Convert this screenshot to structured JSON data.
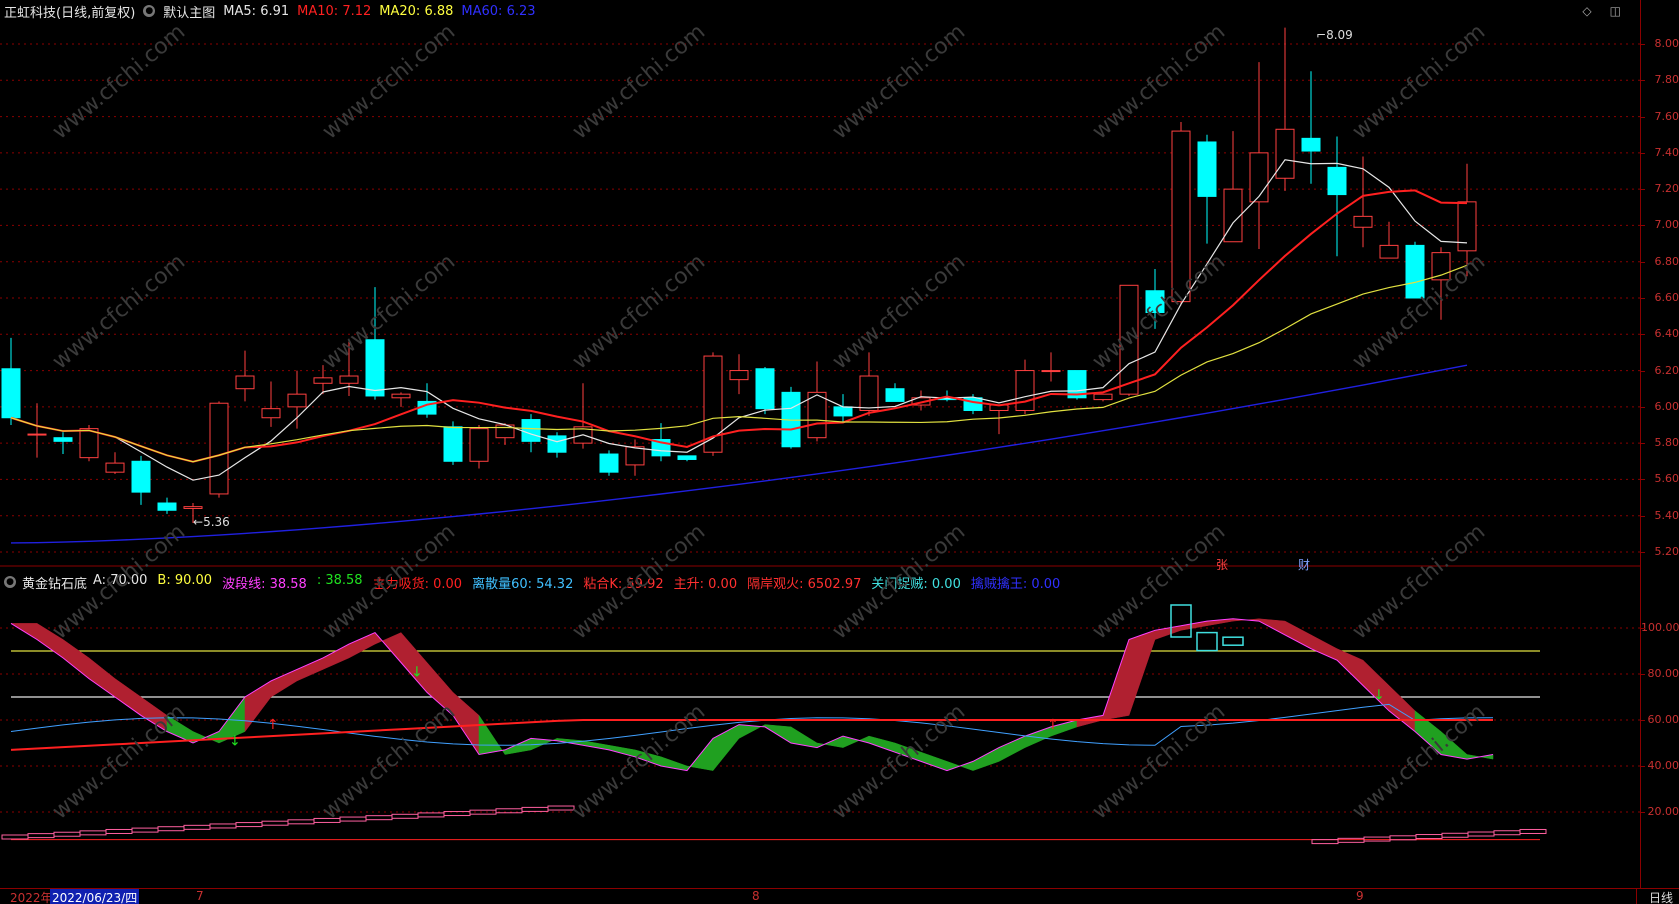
{
  "main_header": {
    "stock_name": "正虹科技(日线,前复权)",
    "chart_name": "默认主图",
    "ma": [
      {
        "label": "MA5:",
        "value": "6.91",
        "color": "#e6e6e6"
      },
      {
        "label": "MA10:",
        "value": "7.12",
        "color": "#ff2020"
      },
      {
        "label": "MA20:",
        "value": "6.88",
        "color": "#ffff40"
      },
      {
        "label": "MA60:",
        "value": "6.23",
        "color": "#3030ff"
      }
    ]
  },
  "sub_header": {
    "indicator_name": "黄金钻石底",
    "items": [
      {
        "label": "A:",
        "value": "70.00",
        "color": "#e6e6e6"
      },
      {
        "label": "B:",
        "value": "90.00",
        "color": "#ffff40"
      },
      {
        "label": "波段线:",
        "value": "38.58",
        "color": "#ff40ff"
      },
      {
        "label": ":",
        "value": "38.58",
        "color": "#20e020"
      },
      {
        "label": "主力吸货:",
        "value": "0.00",
        "color": "#ff2020"
      },
      {
        "label": "离散量60:",
        "value": "54.32",
        "color": "#40c0ff"
      },
      {
        "label": "粘合K:",
        "value": "59.92",
        "color": "#ff3030"
      },
      {
        "label": "主升:",
        "value": "0.00",
        "color": "#ff3030"
      },
      {
        "label": "隔岸观火:",
        "value": "6502.97",
        "color": "#ff3030"
      },
      {
        "label": "关门捉贼:",
        "value": "0.00",
        "color": "#40e0e0"
      },
      {
        "label": "擒贼擒王:",
        "value": "0.00",
        "color": "#3030ff"
      }
    ]
  },
  "main_axis": [
    "8.00",
    "7.80",
    "7.60",
    "7.40",
    "7.20",
    "7.00",
    "6.80",
    "6.60",
    "6.40",
    "6.20",
    "6.00",
    "5.80",
    "5.60",
    "5.40",
    "5.20"
  ],
  "sub_axis": [
    "100.00",
    "80.00",
    "60.00",
    "40.00",
    "20.00"
  ],
  "annotations": {
    "high": "8.09",
    "low": "5.36"
  },
  "badges": {
    "zhang": "张",
    "cai": "财"
  },
  "footer": {
    "year": "2022年",
    "date": "2022/06/23/四",
    "months": [
      "7",
      "8",
      "9"
    ],
    "period": "日线"
  },
  "watermark": "www.cfchi.com",
  "colors": {
    "up": "#ff4040",
    "down": "#00ffff",
    "ma5": "#e6e6e6",
    "ma10": "#ff2020",
    "ma20": "#e0e040",
    "ma60": "#2020e0",
    "grid": "#8b0000"
  },
  "chart_data": [
    {
      "type": "candlestick",
      "title": "默认主图",
      "ylim": [
        5.2,
        8.09
      ],
      "candles": [
        [
          6.21,
          5.94,
          6.38,
          5.9
        ],
        [
          5.85,
          5.85,
          6.02,
          5.72
        ],
        [
          5.83,
          5.81,
          5.86,
          5.74
        ],
        [
          5.72,
          5.88,
          5.9,
          5.7
        ],
        [
          5.64,
          5.69,
          5.75,
          5.63
        ],
        [
          5.7,
          5.53,
          5.73,
          5.46
        ],
        [
          5.47,
          5.43,
          5.5,
          5.41
        ],
        [
          5.44,
          5.45,
          5.47,
          5.36
        ],
        [
          5.52,
          6.02,
          6.03,
          5.5
        ],
        [
          6.1,
          6.17,
          6.31,
          6.03
        ],
        [
          5.94,
          5.99,
          6.14,
          5.89
        ],
        [
          6.0,
          6.07,
          6.2,
          5.88
        ],
        [
          6.13,
          6.16,
          6.23,
          6.07
        ],
        [
          6.13,
          6.17,
          6.36,
          6.06
        ],
        [
          6.37,
          6.06,
          6.66,
          6.04
        ],
        [
          6.05,
          6.07,
          6.08,
          6.0
        ],
        [
          6.03,
          5.96,
          6.13,
          5.94
        ],
        [
          5.89,
          5.7,
          5.92,
          5.68
        ],
        [
          5.7,
          5.88,
          5.9,
          5.66
        ],
        [
          5.83,
          5.9,
          5.91,
          5.79
        ],
        [
          5.93,
          5.81,
          5.96,
          5.75
        ],
        [
          5.84,
          5.75,
          5.86,
          5.72
        ],
        [
          5.8,
          5.89,
          6.13,
          5.77
        ],
        [
          5.74,
          5.64,
          5.76,
          5.62
        ],
        [
          5.68,
          5.78,
          5.82,
          5.62
        ],
        [
          5.82,
          5.73,
          5.91,
          5.7
        ],
        [
          5.73,
          5.71,
          5.73,
          5.7
        ],
        [
          5.75,
          6.28,
          6.3,
          5.73
        ],
        [
          6.15,
          6.2,
          6.29,
          6.07
        ],
        [
          6.21,
          5.99,
          6.22,
          5.96
        ],
        [
          6.08,
          5.78,
          6.11,
          5.77
        ],
        [
          5.83,
          6.08,
          6.25,
          5.81
        ],
        [
          6.0,
          5.95,
          6.07,
          5.91
        ],
        [
          5.98,
          6.17,
          6.3,
          5.95
        ],
        [
          6.1,
          6.03,
          6.13,
          6.03
        ],
        [
          6.01,
          6.05,
          6.09,
          5.98
        ],
        [
          6.05,
          6.04,
          6.09,
          6.03
        ],
        [
          6.05,
          5.98,
          6.07,
          5.96
        ],
        [
          5.98,
          6.01,
          6.01,
          5.85
        ],
        [
          5.98,
          6.2,
          6.26,
          5.96
        ],
        [
          6.2,
          6.2,
          6.3,
          6.14
        ],
        [
          6.2,
          6.05,
          6.2,
          6.04
        ],
        [
          6.04,
          6.07,
          6.07,
          6.03
        ],
        [
          6.07,
          6.67,
          6.67,
          6.06
        ],
        [
          6.64,
          6.52,
          6.76,
          6.43
        ],
        [
          6.58,
          7.52,
          7.57,
          6.56
        ],
        [
          7.46,
          7.16,
          7.5,
          6.9
        ],
        [
          6.91,
          7.2,
          7.52,
          6.91
        ],
        [
          7.13,
          7.4,
          7.9,
          6.87
        ],
        [
          7.26,
          7.53,
          8.09,
          7.19
        ],
        [
          7.48,
          7.41,
          7.85,
          7.23
        ],
        [
          7.32,
          7.17,
          7.49,
          6.83
        ],
        [
          6.99,
          7.05,
          7.38,
          6.88
        ],
        [
          6.82,
          6.89,
          7.02,
          6.83
        ],
        [
          6.89,
          6.6,
          6.91,
          6.6
        ],
        [
          6.7,
          6.85,
          6.88,
          6.48
        ],
        [
          6.86,
          7.13,
          7.34,
          6.72
        ]
      ]
    },
    {
      "type": "line",
      "title": "黄金钻石底",
      "ylim": [
        0,
        110
      ],
      "series": [
        {
          "name": "A",
          "values": [
            70
          ]
        },
        {
          "name": "B",
          "values": [
            90
          ]
        },
        {
          "name": "波段线",
          "values": [
            102,
            95,
            87,
            78,
            70,
            62,
            55,
            50,
            55,
            70,
            77,
            82,
            87,
            93,
            98,
            85,
            72,
            62,
            45,
            47,
            52,
            51,
            49,
            47,
            44,
            40,
            38,
            52,
            58,
            57,
            50,
            48,
            53,
            50,
            46,
            42,
            38,
            42,
            48,
            53,
            57,
            60,
            62,
            95,
            99,
            101,
            103,
            104,
            103,
            97,
            91,
            86,
            75,
            64,
            55,
            45,
            43,
            45
          ]
        },
        {
          "name": "离散量60",
          "values": [
            54.32
          ]
        },
        {
          "name": "粘合K",
          "values": [
            59.92
          ]
        }
      ]
    }
  ]
}
